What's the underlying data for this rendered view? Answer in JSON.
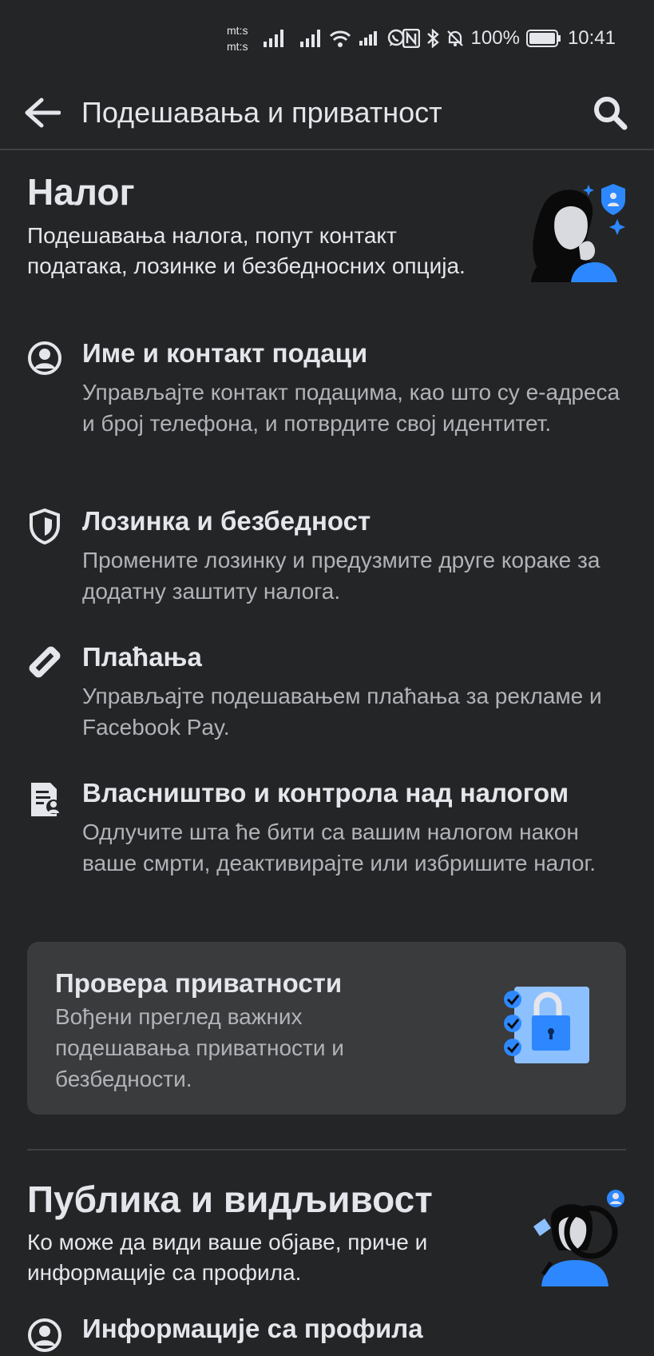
{
  "status_bar": {
    "carrier_1": "mt:s",
    "carrier_2": "mt:s",
    "battery": "100%",
    "time": "10:41"
  },
  "header": {
    "title": "Подешавања и приватност"
  },
  "account": {
    "title": "Налог",
    "description": "Подешавања налога, попут контакт података, лозинке и безбедносних опција.",
    "items": [
      {
        "icon": "user-circle-icon",
        "title": "Име и контакт подаци",
        "description": "Управљајте контакт подацима, као што су е-адреса и број телефона, и потврдите свој идентитет."
      },
      {
        "icon": "shield-icon",
        "title": "Лозинка и безбедност",
        "description": "Промените лозинку и предузмите друге кораке за додатну заштиту налога."
      },
      {
        "icon": "tag-icon",
        "title": "Плаћања",
        "description": "Управљајте подешавањем плаћања за рекламе и Facebook Pay."
      },
      {
        "icon": "document-person-icon",
        "title": "Власништво и контрола над налогом",
        "description": "Одлучите шта ће бити са вашим налогом након ваше смрти, деактивирајте или избришите налог."
      }
    ]
  },
  "privacy_checkup": {
    "title": "Провера приватности",
    "description": "Вођени преглед важних подешавања приватности и безбедности."
  },
  "audience": {
    "title": "Публика и видљивост",
    "description": "Ко може да види ваше објаве, приче и информације са профила.",
    "items": [
      {
        "icon": "user-circle-icon",
        "title": "Информације са профила"
      }
    ]
  },
  "colors": {
    "background": "#242526",
    "text_primary": "#e4e6eb",
    "text_secondary": "#b0b3b8",
    "accent": "#2d88ff",
    "card": "#3a3b3c"
  }
}
